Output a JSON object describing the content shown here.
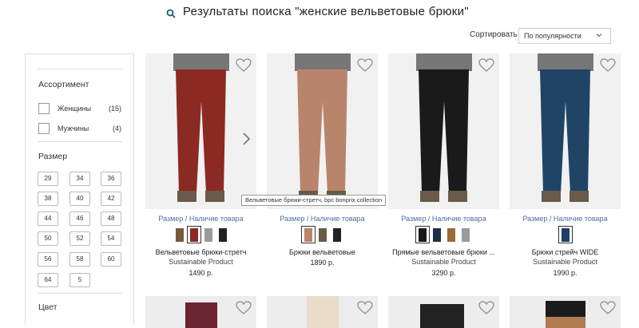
{
  "header": {
    "title": "Результаты поиска \"женские вельветовые брюки\"",
    "search_icon": "search-icon"
  },
  "sort": {
    "label": "Сортировать",
    "selected": "По популярности"
  },
  "sidebar": {
    "assortment_heading": "Ассортимент",
    "filters": [
      {
        "label": "Женщины",
        "count": "(15)",
        "checked": false
      },
      {
        "label": "Мужчины",
        "count": "(4)",
        "checked": false
      }
    ],
    "size_heading": "Размер",
    "sizes": [
      "29",
      "34",
      "36",
      "38",
      "40",
      "42",
      "44",
      "46",
      "48",
      "50",
      "52",
      "54",
      "56",
      "58",
      "60",
      "64",
      "5"
    ],
    "color_heading": "Цвет"
  },
  "products": [
    {
      "link": "Размер / Наличие товара",
      "name": "Вельветовые брюки-стретч",
      "sub": "Sustainable Product",
      "price": "1490 р.",
      "pant_color": "#8b2a22",
      "swatches": [
        "#7a5a3c",
        "#8b2a22",
        "#9a9a9a",
        "#222222"
      ],
      "selected_swatch": 1
    },
    {
      "link": "Размер / Наличие товара",
      "name": "Брюки вельветовые",
      "sub": "",
      "price": "1890 р.",
      "pant_color": "#b9846c",
      "swatches": [
        "#b9846c",
        "#6b5a44",
        "#222222"
      ],
      "selected_swatch": 0
    },
    {
      "link": "Размер / Наличие товара",
      "name": "Прямые вельветовые брюки ...",
      "sub": "Sustainable Product",
      "price": "3290 р.",
      "pant_color": "#1a1a1a",
      "swatches": [
        "#1a1a1a",
        "#1e2d4a",
        "#9a6a38",
        "#9a9a9a"
      ],
      "selected_swatch": 0
    },
    {
      "link": "Размер / Наличие товара",
      "name": "Брюки стрейч WIDE",
      "sub": "Sustainable Product",
      "price": "1990 р.",
      "pant_color": "#1f4466",
      "swatches": [
        "#1f3f66"
      ],
      "selected_swatch": 0
    }
  ],
  "tooltip": "Вельветовые брюки-стретч, bpc bonprix collection",
  "colors": {
    "link": "#4a6fa5",
    "border": "#dddddd"
  }
}
